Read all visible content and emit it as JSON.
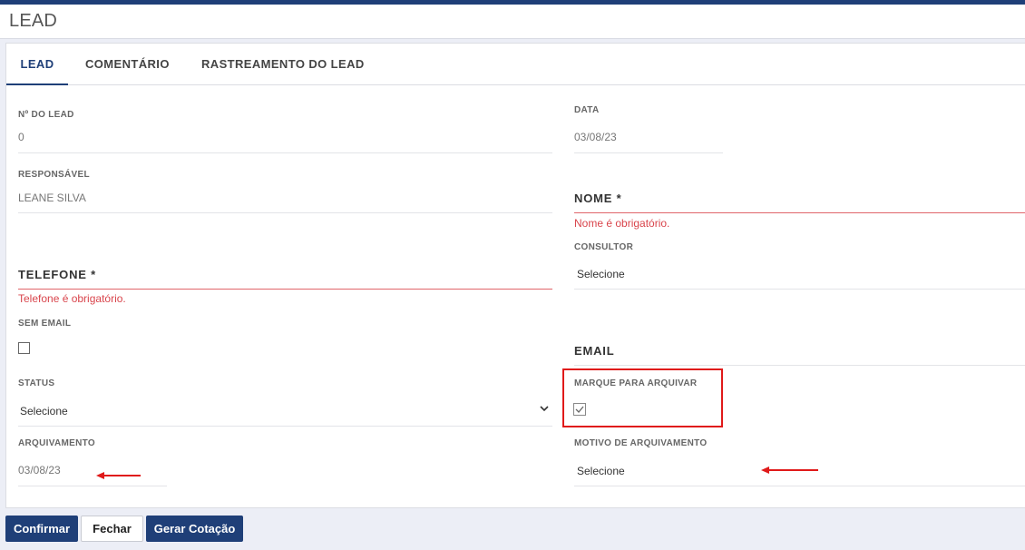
{
  "header": {
    "title": "LEAD"
  },
  "tabs": [
    {
      "label": "LEAD",
      "active": true
    },
    {
      "label": "COMENTÁRIO",
      "active": false
    },
    {
      "label": "RASTREAMENTO DO LEAD",
      "active": false
    }
  ],
  "form": {
    "lead_number": {
      "label": "Nº DO LEAD",
      "value": "0"
    },
    "data": {
      "label": "DATA",
      "value": "03/08/23"
    },
    "responsavel": {
      "label": "RESPONSÁVEL",
      "value": "LEANE SILVA"
    },
    "nome": {
      "label": "NOME *",
      "error": "Nome é obrigatório."
    },
    "consultor": {
      "label": "CONSULTOR",
      "value": "Selecione"
    },
    "telefone": {
      "label": "TELEFONE *",
      "error": "Telefone é obrigatório."
    },
    "sem_email": {
      "label": "SEM EMAIL",
      "checked": false
    },
    "email": {
      "label": "EMAIL"
    },
    "status": {
      "label": "STATUS",
      "value": "Selecione"
    },
    "arquivar": {
      "label": "MARQUE PARA ARQUIVAR",
      "checked": true
    },
    "arquivamento": {
      "label": "ARQUIVAMENTO",
      "value": "03/08/23"
    },
    "motivo": {
      "label": "MOTIVO DE ARQUIVAMENTO",
      "value": "Selecione"
    }
  },
  "buttons": {
    "confirm": "Confirmar",
    "close": "Fechar",
    "quote": "Gerar Cotação"
  },
  "colors": {
    "primary": "#1f3f78",
    "error": "#d9454c",
    "highlight": "#e01a1a"
  }
}
